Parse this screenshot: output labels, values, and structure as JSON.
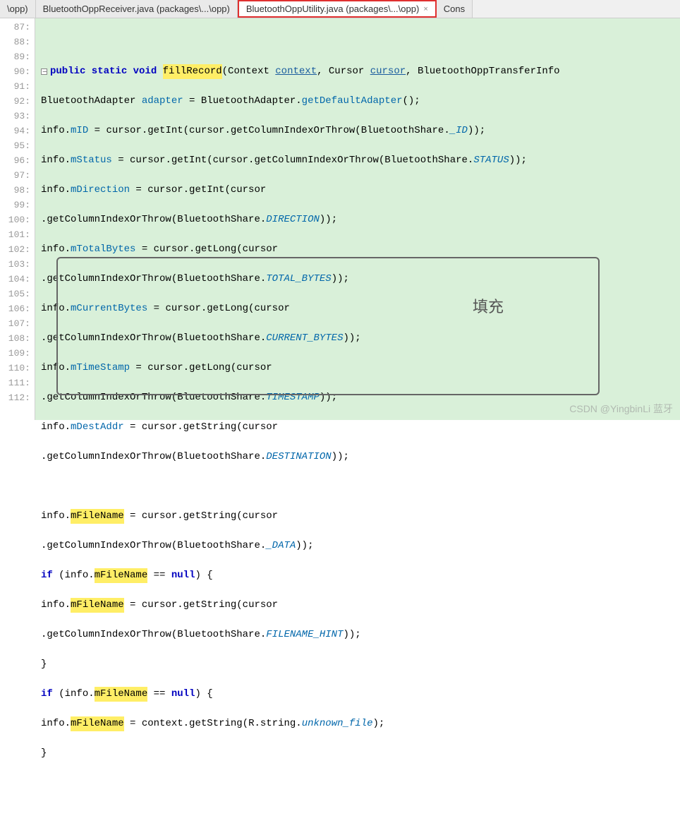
{
  "tabs": [
    {
      "label": "\\opp)"
    },
    {
      "label": "BluetoothOppReceiver.java (packages\\...\\opp)"
    },
    {
      "label": "BluetoothOppUtility.java (packages\\...\\opp)",
      "active": true
    },
    {
      "label": "Cons"
    }
  ],
  "close_icon": "×",
  "line_start": 87,
  "line_end": 112,
  "annotation": "填充",
  "watermark": "CSDN @YingbinLi 蓝牙",
  "code": {
    "l88_a": "public static void ",
    "l88_m": "fillRecord",
    "l88_b": "(Context ",
    "l88_p1": "context",
    "l88_c": ", Cursor ",
    "l88_p2": "cursor",
    "l88_d": ", BluetoothOppTransferInfo",
    "l89_a": "BluetoothAdapter ",
    "l89_b": "adapter",
    "l89_c": " = BluetoothAdapter.",
    "l89_d": "getDefaultAdapter",
    "l89_e": "();",
    "l90_a": "info.",
    "l90_b": "mID",
    "l90_c": " = cursor.getInt(cursor.getColumnIndexOrThrow(BluetoothShare.",
    "l90_d": "_ID",
    "l90_e": "));",
    "l91_a": "info.",
    "l91_b": "mStatus",
    "l91_c": " = cursor.getInt(cursor.getColumnIndexOrThrow(BluetoothShare.",
    "l91_d": "STATUS",
    "l91_e": "));",
    "l92_a": "info.",
    "l92_b": "mDirection",
    "l92_c": " = cursor.getInt(cursor",
    "l93_a": ".getColumnIndexOrThrow(BluetoothShare.",
    "l93_b": "DIRECTION",
    "l93_c": "));",
    "l94_a": "info.",
    "l94_b": "mTotalBytes",
    "l94_c": " = cursor.getLong(cursor",
    "l95_a": ".getColumnIndexOrThrow(BluetoothShare.",
    "l95_b": "TOTAL_BYTES",
    "l95_c": "));",
    "l96_a": "info.",
    "l96_b": "mCurrentBytes",
    "l96_c": " = cursor.getLong(cursor",
    "l97_a": ".getColumnIndexOrThrow(BluetoothShare.",
    "l97_b": "CURRENT_BYTES",
    "l97_c": "));",
    "l98_a": "info.",
    "l98_b": "mTimeStamp",
    "l98_c": " = cursor.getLong(cursor",
    "l99_a": ".getColumnIndexOrThrow(BluetoothShare.",
    "l99_b": "TIMESTAMP",
    "l99_c": "));",
    "l100_a": "info.",
    "l100_b": "mDestAddr",
    "l100_c": " = cursor.getString(cursor",
    "l101_a": ".getColumnIndexOrThrow(BluetoothShare.",
    "l101_b": "DESTINATION",
    "l101_c": "));",
    "l103_a": "info.",
    "l103_b": "mFileName",
    "l103_c": " = cursor.getString(cursor",
    "l104_a": ".getColumnIndexOrThrow(BluetoothShare.",
    "l104_b": "_DATA",
    "l104_c": "));",
    "l105_a": "if",
    "l105_b": " (info.",
    "l105_c": "mFileName",
    "l105_d": " == ",
    "l105_e": "null",
    "l105_f": ") {",
    "l106_a": "info.",
    "l106_b": "mFileName",
    "l106_c": " = cursor.getString(cursor",
    "l107_a": ".getColumnIndexOrThrow(BluetoothShare.",
    "l107_b": "FILENAME_HINT",
    "l107_c": "));",
    "l108_a": "}",
    "l109_a": "if",
    "l109_b": " (info.",
    "l109_c": "mFileName",
    "l109_d": " == ",
    "l109_e": "null",
    "l109_f": ") {",
    "l110_a": "info.",
    "l110_b": "mFileName",
    "l110_c": " = context.getString(R.string.",
    "l110_d": "unknown_file",
    "l110_e": ");",
    "l111_a": "}"
  }
}
